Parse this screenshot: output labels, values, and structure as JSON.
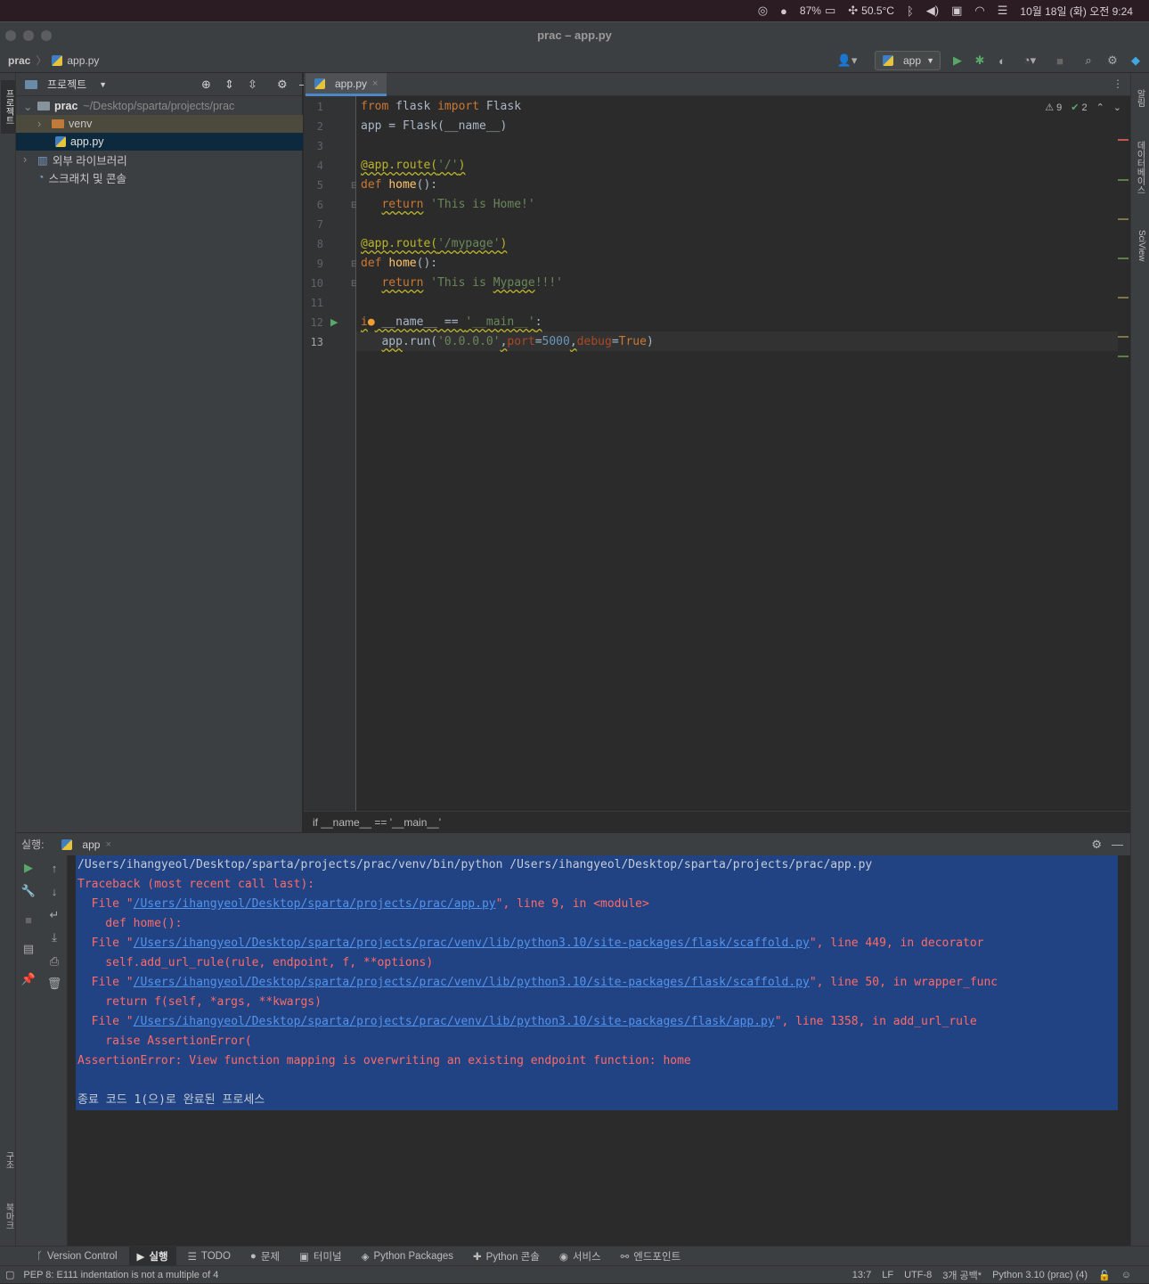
{
  "menubar": {
    "battery": "87%",
    "temperature": "50.5°C",
    "datetime": "10월 18일 (화) 오전 9:24"
  },
  "window": {
    "title": "prac – app.py"
  },
  "navbar": {
    "project": "prac",
    "file": "app.py",
    "run_config": "app"
  },
  "project_panel": {
    "title": "프로젝트",
    "root_name": "prac",
    "root_path": "~/Desktop/sparta/projects/prac",
    "items": [
      "venv",
      "app.py",
      "외부 라이브러리",
      "스크래치 및 콘솔"
    ]
  },
  "left_strip": {
    "project": "프로젝트",
    "structure": "구조",
    "bookmarks": "북마크"
  },
  "right_strip": {
    "notifications": "알림",
    "database": "데이터베이스",
    "sciview": "SciView"
  },
  "editor": {
    "tab": "app.py",
    "warnings": "9",
    "weak_warnings": "2",
    "line_numbers": [
      "1",
      "2",
      "3",
      "4",
      "5",
      "6",
      "7",
      "8",
      "9",
      "10",
      "11",
      "12",
      "13"
    ],
    "breadcrumb": "if __name__ == '__main__'"
  },
  "run_panel": {
    "label": "실행:",
    "tab": "app",
    "console": {
      "cmd": "/Users/ihangyeol/Desktop/sparta/projects/prac/venv/bin/python /Users/ihangyeol/Desktop/sparta/projects/prac/app.py",
      "traceback": "Traceback (most recent call last):",
      "f1_pre": "  File \"",
      "f1_link": "/Users/ihangyeol/Desktop/sparta/projects/prac/app.py",
      "f1_post": "\", line 9, in <module>",
      "f1_code": "    def home():",
      "f2_pre": "  File \"",
      "f2_link": "/Users/ihangyeol/Desktop/sparta/projects/prac/venv/lib/python3.10/site-packages/flask/scaffold.py",
      "f2_post": "\", line 449, in decorator",
      "f2_code": "    self.add_url_rule(rule, endpoint, f, **options)",
      "f3_pre": "  File \"",
      "f3_link": "/Users/ihangyeol/Desktop/sparta/projects/prac/venv/lib/python3.10/site-packages/flask/scaffold.py",
      "f3_post": "\", line 50, in wrapper_func",
      "f3_code": "    return f(self, *args, **kwargs)",
      "f4_pre": "  File \"",
      "f4_link": "/Users/ihangyeol/Desktop/sparta/projects/prac/venv/lib/python3.10/site-packages/flask/app.py",
      "f4_post": "\", line 1358, in add_url_rule",
      "f4_code": "    raise AssertionError(",
      "error": "AssertionError: View function mapping is overwriting an existing endpoint function: home",
      "exit": "종료 코드 1(으)로 완료된 프로세스"
    }
  },
  "toolwindows": [
    "Version Control",
    "실행",
    "TODO",
    "문제",
    "터미널",
    "Python Packages",
    "Python 콘솔",
    "서비스",
    "엔드포인트"
  ],
  "status": {
    "message": "PEP 8: E111 indentation is not a multiple of 4",
    "position": "13:7",
    "line_sep": "LF",
    "encoding": "UTF-8",
    "indent": "3개 공백*",
    "interpreter": "Python 3.10 (prac) (4)"
  }
}
